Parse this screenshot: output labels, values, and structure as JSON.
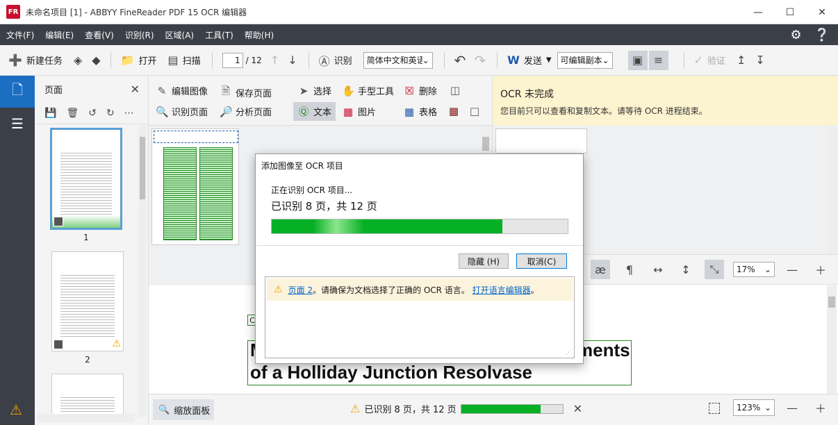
{
  "window": {
    "logo_text": "FR",
    "title": "未命名项目 [1] - ABBYY FineReader PDF 15 OCR 编辑器"
  },
  "menu": [
    "文件(F)",
    "编辑(E)",
    "查看(V)",
    "识别(R)",
    "区域(A)",
    "工具(T)",
    "帮助(H)"
  ],
  "toolbar": {
    "new_task": "新建任务",
    "open": "打开",
    "scan": "扫描",
    "page_current": "1",
    "page_total": "/ 12",
    "recognize": "识别",
    "language": "简体中文和英语",
    "send": "发送",
    "output_format": "可编辑副本",
    "verify": "验证"
  },
  "pages_panel": {
    "title": "页面",
    "thumbs": [
      {
        "num": "1"
      },
      {
        "num": "2"
      }
    ]
  },
  "image_toolbar": {
    "edit_image": "编辑图像",
    "save_page": "保存页面",
    "recognize_page": "识别页面",
    "analyze_page": "分析页面",
    "select": "选择",
    "hand_tool": "手型工具",
    "delete": "删除",
    "text": "文本",
    "picture": "图片",
    "table": "表格"
  },
  "ocr_banner": {
    "title": "OCR 未完成",
    "message": "您目前只可以查看和复制文本。请等待 OCR 进程结束。"
  },
  "text_toolbar": {
    "zoom": "17%"
  },
  "text_area": {
    "small_char": "C",
    "line1_start": "M",
    "line1_end": "ments",
    "line2": "of a Holliday Junction Resolvase"
  },
  "status_bar": {
    "zoom_panel": "缩放面板",
    "status_text": "已识别 8 页，共 12 页",
    "progress": 0.78,
    "zoom": "123%"
  },
  "dialog": {
    "title": "添加图像至 OCR 项目",
    "status": "正在识别 OCR 项目...",
    "count": "已识别 8 页，共 12 页",
    "progress": 0.78,
    "hide_button": "隐藏 (H)",
    "cancel_button": "取消(C)",
    "warning": {
      "link_page": "页面 2",
      "text": "。请确保为文档选择了正确的 OCR 语言。",
      "link_editor": "打开语言编辑器",
      "end": "。"
    }
  }
}
